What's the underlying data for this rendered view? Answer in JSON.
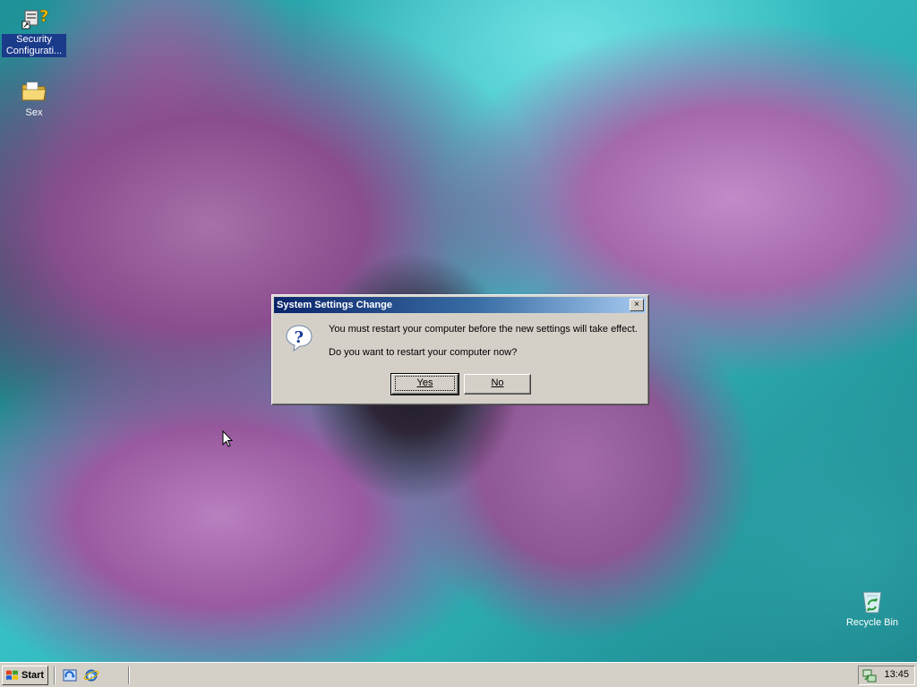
{
  "desktop": {
    "icons": [
      {
        "label": "Security Configurati...",
        "icon": "security-shortcut-icon",
        "selected": true
      },
      {
        "label": "Sex",
        "icon": "folder-icon",
        "selected": false
      },
      {
        "label": "Recycle Bin",
        "icon": "recycle-bin-icon",
        "selected": false
      }
    ]
  },
  "dialog": {
    "title": "System Settings Change",
    "close_label": "×",
    "icon": "question-icon",
    "message": "You must restart your computer before the new settings will take effect.",
    "question": "Do you want to restart your computer now?",
    "yes_label": "Yes",
    "no_label": "No"
  },
  "taskbar": {
    "start_label": "Start",
    "quick_launch": [
      "show-desktop-icon",
      "internet-explorer-icon"
    ],
    "tray_icon": "network-icon",
    "clock": "13:45"
  },
  "colors": {
    "title_bar_start": "#0a246a",
    "title_bar_end": "#a6caf0",
    "chrome": "#d4d0c8"
  }
}
